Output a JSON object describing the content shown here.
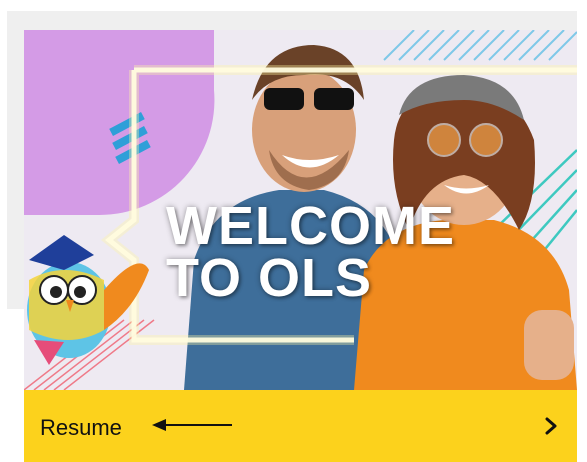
{
  "banner": {
    "headline_line1": "WELCOME",
    "headline_line2": "TO OLS"
  },
  "resume_bar": {
    "label": "Resume",
    "arrow_icon": "arrow-left-icon",
    "chevron_icon": "chevron-right-icon"
  },
  "colors": {
    "accent_yellow": "#fcd21c",
    "purple": "#d49be6",
    "teal": "#3ec9c0",
    "orange_sweater": "#f08a1e"
  }
}
